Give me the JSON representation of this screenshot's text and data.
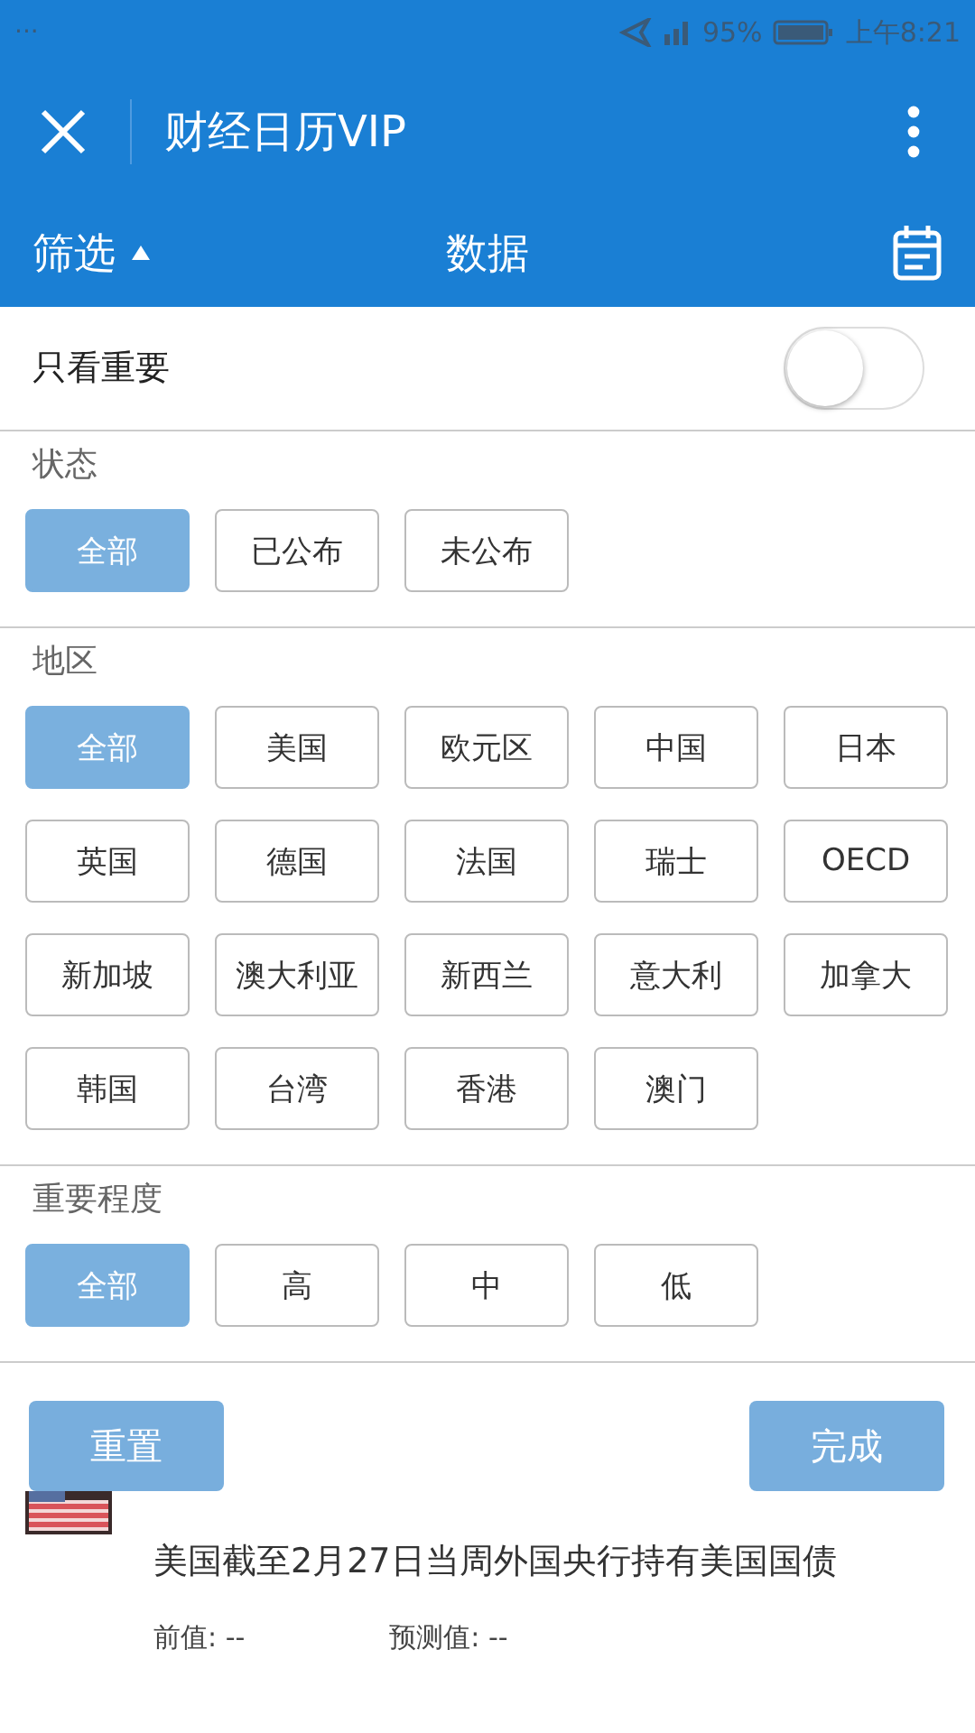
{
  "status_bar": {
    "dots": "···",
    "battery": "95%",
    "time": "上午8:21"
  },
  "header": {
    "title": "财经日历VIP"
  },
  "filter_bar": {
    "filter_label": "筛选",
    "expanded": true,
    "title": "数据"
  },
  "important_only": {
    "label": "只看重要",
    "on": false
  },
  "sections": [
    {
      "title": "状态",
      "options": [
        {
          "label": "全部",
          "selected": true
        },
        {
          "label": "已公布",
          "selected": false
        },
        {
          "label": "未公布",
          "selected": false
        }
      ]
    },
    {
      "title": "地区",
      "options": [
        {
          "label": "全部",
          "selected": true
        },
        {
          "label": "美国",
          "selected": false
        },
        {
          "label": "欧元区",
          "selected": false
        },
        {
          "label": "中国",
          "selected": false
        },
        {
          "label": "日本",
          "selected": false
        },
        {
          "label": "英国",
          "selected": false
        },
        {
          "label": "德国",
          "selected": false
        },
        {
          "label": "法国",
          "selected": false
        },
        {
          "label": "瑞士",
          "selected": false
        },
        {
          "label": "OECD",
          "selected": false
        },
        {
          "label": "新加坡",
          "selected": false
        },
        {
          "label": "澳大利亚",
          "selected": false
        },
        {
          "label": "新西兰",
          "selected": false
        },
        {
          "label": "意大利",
          "selected": false
        },
        {
          "label": "加拿大",
          "selected": false
        },
        {
          "label": "韩国",
          "selected": false
        },
        {
          "label": "台湾",
          "selected": false
        },
        {
          "label": "香港",
          "selected": false
        },
        {
          "label": "澳门",
          "selected": false
        }
      ]
    },
    {
      "title": "重要程度",
      "options": [
        {
          "label": "全部",
          "selected": true
        },
        {
          "label": "高",
          "selected": false
        },
        {
          "label": "中",
          "selected": false
        },
        {
          "label": "低",
          "selected": false
        }
      ]
    }
  ],
  "buttons": {
    "reset": "重置",
    "done": "完成"
  },
  "events": [
    {
      "title": "美国截至2月27日当周外国央行持有美国国债",
      "previous": "前值: --",
      "forecast": "预测值: --"
    }
  ]
}
